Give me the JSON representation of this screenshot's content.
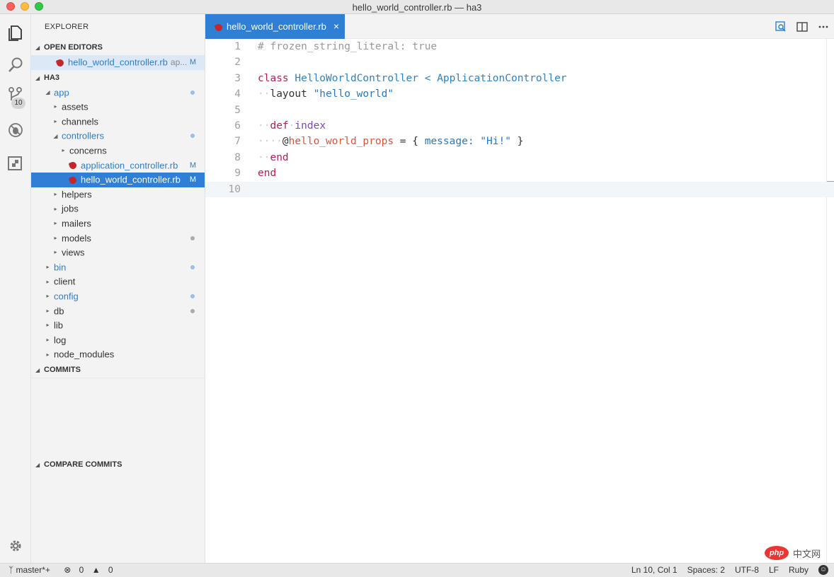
{
  "window": {
    "title": "hello_world_controller.rb — ha3"
  },
  "activity": {
    "scm_badge": "10"
  },
  "sidebar": {
    "explorer_title": "EXPLORER",
    "open_editors_title": "OPEN EDITORS",
    "open_editor": {
      "name": "hello_world_controller.rb",
      "desc": "ap...",
      "status": "M"
    },
    "project_title": "HA3",
    "tree": [
      {
        "label": "app",
        "depth": 1,
        "expanded": true,
        "modified": true,
        "decoration": "dot"
      },
      {
        "label": "assets",
        "depth": 2,
        "expanded": false
      },
      {
        "label": "channels",
        "depth": 2,
        "expanded": false
      },
      {
        "label": "controllers",
        "depth": 2,
        "expanded": true,
        "modified": true,
        "decoration": "dot"
      },
      {
        "label": "concerns",
        "depth": 3,
        "expanded": false
      },
      {
        "label": "application_controller.rb",
        "depth": 3,
        "file": true,
        "modified": true,
        "status": "M"
      },
      {
        "label": "hello_world_controller.rb",
        "depth": 3,
        "file": true,
        "selected": true,
        "status": "M"
      },
      {
        "label": "helpers",
        "depth": 2,
        "expanded": false
      },
      {
        "label": "jobs",
        "depth": 2,
        "expanded": false
      },
      {
        "label": "mailers",
        "depth": 2,
        "expanded": false
      },
      {
        "label": "models",
        "depth": 2,
        "expanded": false,
        "decoration": "grey-dot"
      },
      {
        "label": "views",
        "depth": 2,
        "expanded": false
      },
      {
        "label": "bin",
        "depth": 1,
        "expanded": false,
        "modified": true,
        "decoration": "dot"
      },
      {
        "label": "client",
        "depth": 1,
        "expanded": false
      },
      {
        "label": "config",
        "depth": 1,
        "expanded": false,
        "modified": true,
        "decoration": "dot"
      },
      {
        "label": "db",
        "depth": 1,
        "expanded": false,
        "decoration": "grey-dot"
      },
      {
        "label": "lib",
        "depth": 1,
        "expanded": false
      },
      {
        "label": "log",
        "depth": 1,
        "expanded": false
      },
      {
        "label": "node_modules",
        "depth": 1,
        "expanded": false
      }
    ],
    "commits_title": "COMMITS",
    "compare_title": "COMPARE COMMITS"
  },
  "editor": {
    "tab_label": "hello_world_controller.rb",
    "tab_close": "×",
    "current_line": 10,
    "lines": [
      {
        "n": "1",
        "tokens": [
          [
            "c-comment",
            "# frozen_string_literal: true"
          ]
        ]
      },
      {
        "n": "2",
        "tokens": []
      },
      {
        "n": "3",
        "tokens": [
          [
            "c-kw",
            "class"
          ],
          [
            "",
            " "
          ],
          [
            "c-cls",
            "HelloWorldController"
          ],
          [
            "",
            " "
          ],
          [
            "c-cls",
            "<"
          ],
          [
            "",
            " "
          ],
          [
            "c-cls",
            "ApplicationController"
          ]
        ]
      },
      {
        "n": "4",
        "tokens": [
          [
            "c-ws",
            "··"
          ],
          [
            "",
            "layout "
          ],
          [
            "c-str",
            "\"hello_world\""
          ]
        ]
      },
      {
        "n": "5",
        "tokens": []
      },
      {
        "n": "6",
        "tokens": [
          [
            "c-ws",
            "··"
          ],
          [
            "c-kw",
            "def"
          ],
          [
            "c-ws",
            "·"
          ],
          [
            "c-fn",
            "index"
          ]
        ]
      },
      {
        "n": "7",
        "tokens": [
          [
            "c-ws",
            "····"
          ],
          [
            "",
            "@"
          ],
          [
            "c-ivar",
            "hello_world_props"
          ],
          [
            "",
            " = { "
          ],
          [
            "c-sym",
            "message:"
          ],
          [
            "",
            " "
          ],
          [
            "c-str",
            "\"Hi!\""
          ],
          [
            "",
            " }"
          ]
        ]
      },
      {
        "n": "8",
        "tokens": [
          [
            "c-ws",
            "··"
          ],
          [
            "c-kw",
            "end"
          ]
        ]
      },
      {
        "n": "9",
        "tokens": [
          [
            "c-kw",
            "end"
          ]
        ]
      },
      {
        "n": "10",
        "tokens": []
      }
    ]
  },
  "status": {
    "branch": "master*+",
    "errors": "0",
    "warnings": "0",
    "position": "Ln 10, Col 1",
    "spaces": "Spaces: 2",
    "encoding": "UTF-8",
    "eol": "LF",
    "language": "Ruby"
  },
  "watermark": {
    "logo": "php",
    "text": "中文网"
  }
}
